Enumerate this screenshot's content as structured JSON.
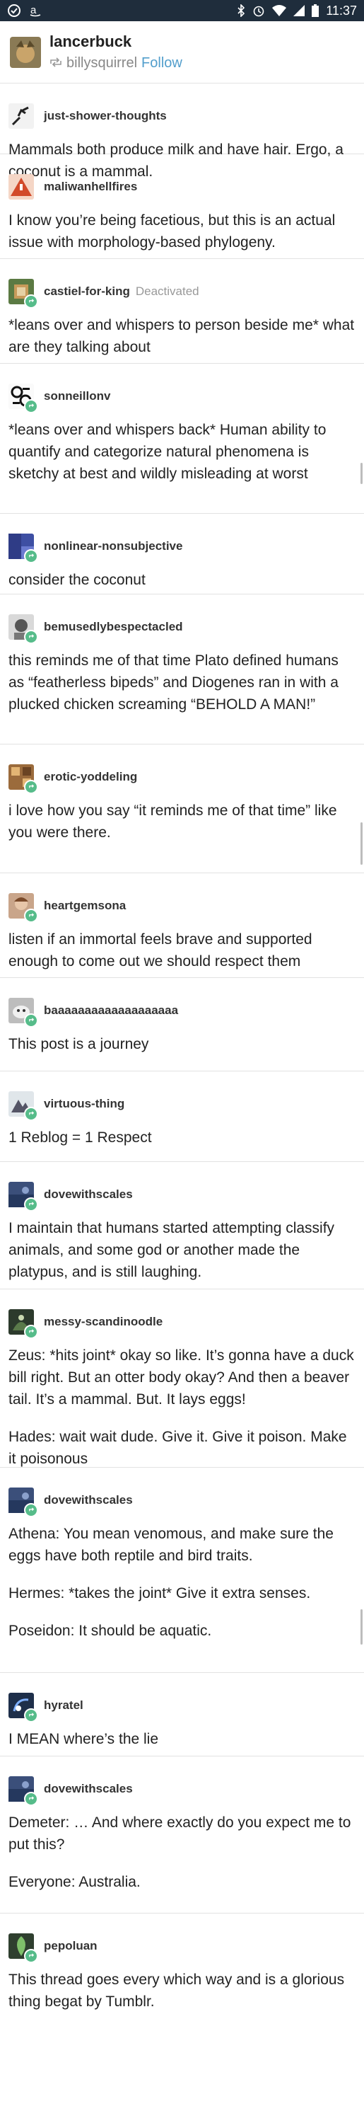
{
  "status_bar": {
    "time": "11:37"
  },
  "header": {
    "username": "lancerbuck",
    "reblogged_from": "billysquirrel",
    "follow_label": "Follow"
  },
  "posts": [
    {
      "username": "just-shower-thoughts",
      "text": [
        "Mammals both produce milk and have hair. Ergo, a coconut is a mammal."
      ]
    },
    {
      "username": "maliwanhellfires",
      "text": [
        "I know you’re being facetious, but this is an actual issue with morphology-based phylogeny."
      ]
    },
    {
      "username": "castiel-for-king",
      "status": "Deactivated",
      "text": [
        "*leans over and whispers to person beside me* what are they talking about"
      ]
    },
    {
      "username": "sonneillonv",
      "text": [
        "*leans over and whispers back*  Human ability to quantify and categorize natural phenomena is sketchy at best and wildly misleading at worst"
      ]
    },
    {
      "username": "nonlinear-nonsubjective",
      "text": [
        "consider the coconut"
      ]
    },
    {
      "username": "bemusedlybespectacled",
      "text": [
        "this reminds me of that time Plato defined humans as “featherless bipeds” and Diogenes ran in with a plucked chicken screaming “BEHOLD A MAN!”"
      ]
    },
    {
      "username": "erotic-yoddeling",
      "text": [
        "i love how you say “it reminds me of that time” like you were there."
      ]
    },
    {
      "username": "heartgemsona",
      "text": [
        "listen if an immortal feels brave and supported enough to come out we should respect them"
      ]
    },
    {
      "username": "baaaaaaaaaaaaaaaaaaa",
      "text": [
        "This post is a journey"
      ]
    },
    {
      "username": "virtuous-thing",
      "text": [
        "1 Reblog = 1 Respect"
      ]
    },
    {
      "username": "dovewithscales",
      "text": [
        "I maintain that humans started attempting classify animals, and some god or another made the platypus, and is still laughing."
      ]
    },
    {
      "username": "messy-scandinoodle",
      "text": [
        "Zeus: *hits joint* okay so like. It’s gonna have a duck bill right. But an otter body okay? And then a beaver tail. It’s a mammal. But. It lays eggs!",
        "Hades: wait wait dude. Give it. Give it poison. Make it poisonous"
      ]
    },
    {
      "username": "dovewithscales",
      "text": [
        "Athena: You mean venomous, and make sure the eggs have both reptile and bird traits.",
        "Hermes: *takes the joint* Give it extra senses.",
        "Poseidon: It should be aquatic."
      ]
    },
    {
      "username": "hyratel",
      "text": [
        "I MEAN where’s the lie"
      ]
    },
    {
      "username": "dovewithscales",
      "text": [
        "Demeter: … And where exactly do you expect me to put this?",
        "Everyone: Australia."
      ]
    },
    {
      "username": "pepoluan",
      "text": [
        "This thread goes every which way and is a glorious thing begat by Tumblr."
      ]
    }
  ],
  "colors": {
    "status_bar": "#1f2d3c",
    "follow": "#529ecc",
    "reblog_badge": "#56bc8a"
  }
}
